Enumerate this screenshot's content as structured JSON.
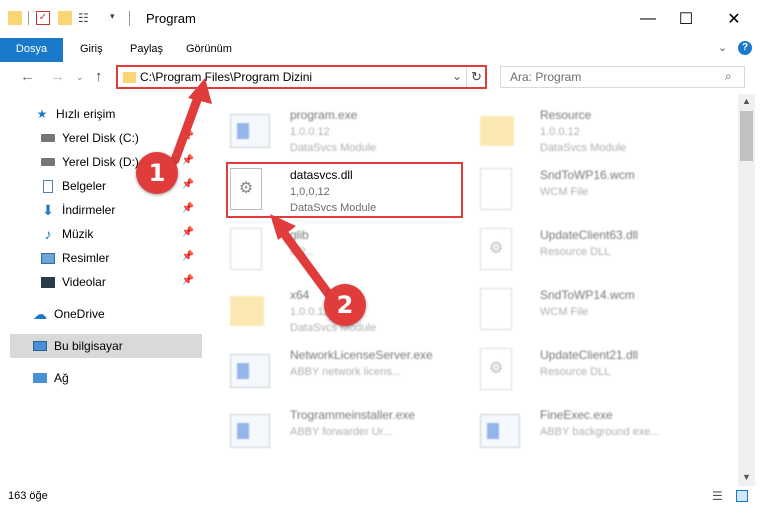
{
  "window": {
    "title": "Program",
    "minimize_icon": "minimize-icon",
    "maximize_icon": "maximize-icon",
    "close_icon": "close-icon"
  },
  "ribbon": {
    "tabs": [
      "Dosya",
      "Giriş",
      "Paylaş",
      "Görünüm"
    ],
    "accent": "#1979ca"
  },
  "address": {
    "path": "C:\\Program Files\\Program Dizini",
    "search_placeholder": "Ara: Program"
  },
  "nav": {
    "quick_access": "Hızlı erişim",
    "items": [
      {
        "label": "Yerel Disk (C:)",
        "icon": "drive-icon",
        "pinned": true
      },
      {
        "label": "Yerel Disk (D:)",
        "icon": "drive-icon",
        "pinned": true
      },
      {
        "label": "Belgeler",
        "icon": "documents-icon",
        "pinned": true
      },
      {
        "label": "İndirmeler",
        "icon": "download-icon",
        "pinned": true
      },
      {
        "label": "Müzik",
        "icon": "music-icon",
        "pinned": true
      },
      {
        "label": "Resimler",
        "icon": "pictures-icon",
        "pinned": true
      },
      {
        "label": "Videolar",
        "icon": "videos-icon",
        "pinned": true
      }
    ],
    "onedrive": "OneDrive",
    "this_pc": "Bu bilgisayar",
    "network": "Ağ"
  },
  "files": {
    "left": [
      {
        "name": "program.exe",
        "version": "1.0.0.12",
        "desc": "DataSvcs Module",
        "icon": "program-icon"
      },
      {
        "name": "datasvcs.dll",
        "version": "1,0,0,12",
        "desc": "DataSvcs Module",
        "icon": "dll-gear-icon"
      },
      {
        "name": "glib",
        "version": "CR...",
        "desc": "",
        "icon": "file-icon"
      },
      {
        "name": "x64",
        "version": "1.0.0.12",
        "desc": "DataSvcs Module",
        "icon": "folder-icon"
      },
      {
        "name": "NetworkLicenseServer.exe",
        "version": "ABBY network licens...",
        "desc": "",
        "icon": "app-icon"
      },
      {
        "name": "Trogrammeinstaller.exe",
        "version": "ABBY forwarder Ur...",
        "desc": "",
        "icon": "app-icon"
      }
    ],
    "right": [
      {
        "name": "Resource",
        "version": "1.0.0.12",
        "desc": "DataSvcs Module",
        "icon": "folder-icon"
      },
      {
        "name": "SndToWP16.wcm",
        "version": "WCM File",
        "desc": "",
        "icon": "file-icon"
      },
      {
        "name": "UpdateClient63.dll",
        "version": "Resource DLL",
        "desc": "",
        "icon": "dll-gear-icon"
      },
      {
        "name": "SndToWP14.wcm",
        "version": "WCM File",
        "desc": "",
        "icon": "file-icon"
      },
      {
        "name": "UpdateClient21.dll",
        "version": "Resource DLL",
        "desc": "",
        "icon": "dll-gear-icon"
      },
      {
        "name": "FineExec.exe",
        "version": "ABBY background exe...",
        "desc": "",
        "icon": "app-icon"
      }
    ]
  },
  "status": {
    "count": "163 öğe"
  },
  "callouts": [
    "1",
    "2"
  ],
  "colors": {
    "highlight": "#e03c3c",
    "selected_nav": "#cce8ff"
  }
}
